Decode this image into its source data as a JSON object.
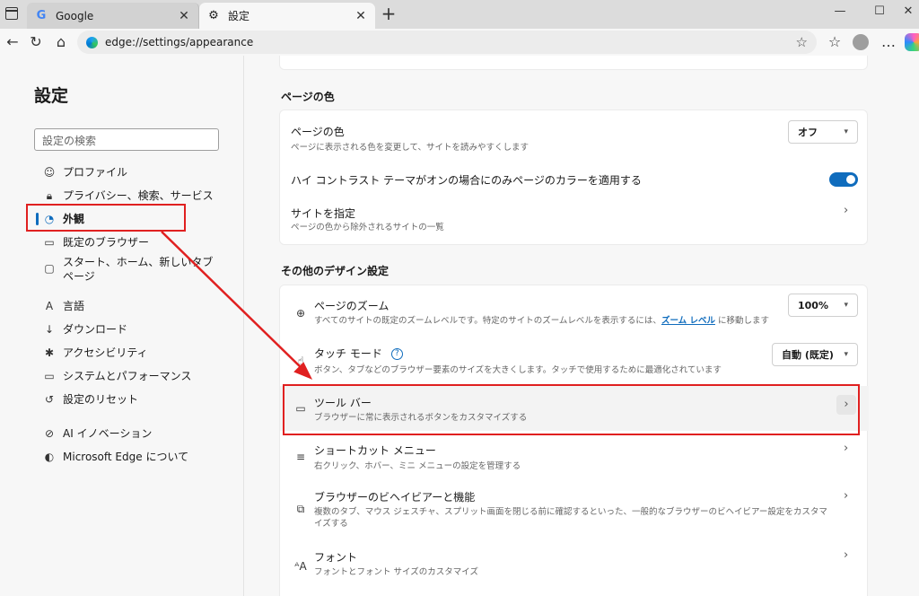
{
  "tabs": [
    {
      "label": "Google",
      "favicon": "google-g-icon",
      "active": false
    },
    {
      "label": "設定",
      "favicon": "gear-icon",
      "active": true
    }
  ],
  "address": {
    "url": "edge://settings/appearance"
  },
  "sidebar": {
    "title": "設定",
    "search_placeholder": "設定の検索",
    "items": [
      {
        "label": "プロファイル",
        "icon": "profile-icon"
      },
      {
        "label": "プライバシー、検索、サービス",
        "icon": "lock-icon"
      },
      {
        "label": "外観",
        "icon": "appearance-icon",
        "active": true
      },
      {
        "label": "既定のブラウザー",
        "icon": "browser-icon"
      },
      {
        "label": "スタート、ホーム、新しいタブ ページ",
        "icon": "home-tab-icon"
      },
      {
        "label": "言語",
        "icon": "language-icon"
      },
      {
        "label": "ダウンロード",
        "icon": "download-icon"
      },
      {
        "label": "アクセシビリティ",
        "icon": "accessibility-icon"
      },
      {
        "label": "システムとパフォーマンス",
        "icon": "system-icon"
      },
      {
        "label": "設定のリセット",
        "icon": "reset-icon"
      },
      {
        "label": "AI イノベーション",
        "icon": "ai-icon"
      },
      {
        "label": "Microsoft Edge について",
        "icon": "edge-icon"
      }
    ]
  },
  "page_color": {
    "section_title": "ページの色",
    "rows": [
      {
        "title": "ページの色",
        "desc": "ページに表示される色を変更して、サイトを読みやすくします",
        "value": "オフ"
      },
      {
        "title": "ハイ コントラスト テーマがオンの場合にのみページのカラーを適用する",
        "toggle_on": true
      },
      {
        "title": "サイトを指定",
        "desc": "ページの色から除外されるサイトの一覧"
      }
    ]
  },
  "other_design": {
    "section_title": "その他のデザイン設定",
    "zoom": {
      "title": "ページのズーム",
      "desc_prefix": "すべてのサイトの既定のズームレベルです。特定のサイトのズームレベルを表示するには、",
      "desc_link": "ズーム レベル",
      "desc_suffix": " に移動します",
      "value": "100%"
    },
    "touch": {
      "title": "タッチ モード",
      "desc": "ボタン、タブなどのブラウザー要素のサイズを大きくします。タッチで使用するために最適化されています",
      "value": "自動 (既定)"
    },
    "toolbar": {
      "title": "ツール バー",
      "desc": "ブラウザーに常に表示されるボタンをカスタマイズする"
    },
    "shortcut": {
      "title": "ショートカット メニュー",
      "desc": "右クリック、ホバー、ミニ メニューの設定を管理する"
    },
    "behavior": {
      "title": "ブラウザーのビヘイビアーと機能",
      "desc": "複数のタブ、マウス ジェスチャ、スプリット画面を閉じる前に確認するといった、一般的なブラウザーのビヘイビアー設定をカスタマイズする"
    },
    "font": {
      "title": "フォント",
      "desc": "フォントとフォント サイズのカスタマイズ"
    }
  },
  "colors": {
    "accent": "#0f6cbd",
    "annotation": "#e02020"
  }
}
